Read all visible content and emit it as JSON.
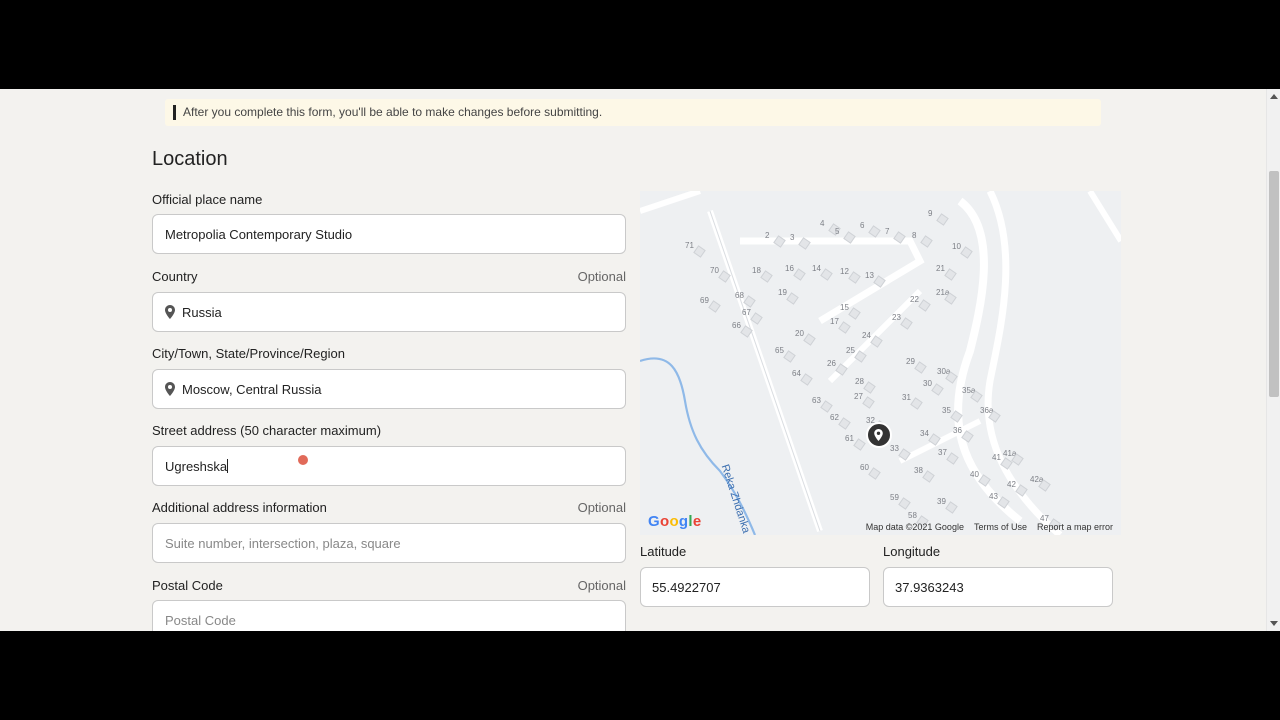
{
  "notice": {
    "text": "After you complete this form, you'll be able to make changes before submitting."
  },
  "section": {
    "title": "Location"
  },
  "form": {
    "place_name": {
      "label": "Official place name",
      "value": "Metropolia Contemporary Studio"
    },
    "country": {
      "label": "Country",
      "optional": "Optional",
      "value": "Russia"
    },
    "city": {
      "label": "City/Town, State/Province/Region",
      "value": "Moscow, Central Russia"
    },
    "street": {
      "label": "Street address (50 character maximum)",
      "value": "Ugreshska"
    },
    "additional": {
      "label": "Additional address information",
      "optional": "Optional",
      "placeholder": "Suite number, intersection, plaza, square"
    },
    "postal": {
      "label": "Postal Code",
      "optional": "Optional",
      "placeholder": "Postal Code"
    }
  },
  "map": {
    "logo": "Google",
    "river_label": "Reka Zhdanka",
    "attribution": "Map data ©2021 Google",
    "terms": "Terms of Use",
    "report": "Report a map error",
    "house_numbers": [
      "71",
      "70",
      "69",
      "68",
      "67",
      "66",
      "65",
      "64",
      "63",
      "62",
      "61",
      "60",
      "59",
      "58",
      "4",
      "2",
      "3",
      "5",
      "6",
      "7",
      "8",
      "9",
      "10",
      "18",
      "16",
      "14",
      "12",
      "13",
      "21",
      "21a",
      "22",
      "19",
      "17",
      "15",
      "23",
      "20",
      "24",
      "25",
      "26",
      "29",
      "30a",
      "27",
      "28",
      "30",
      "31",
      "35a",
      "36a",
      "32",
      "35",
      "34",
      "36",
      "33",
      "37",
      "40",
      "41",
      "41a",
      "38",
      "39",
      "43",
      "42",
      "42a",
      "47"
    ],
    "marker_icon": "location-pin-icon"
  },
  "coordinates": {
    "latitude": {
      "label": "Latitude",
      "value": "55.4922707"
    },
    "longitude": {
      "label": "Longitude",
      "value": "37.9363243"
    }
  },
  "colors": {
    "notice_bg": "#fdf8e7",
    "page_bg": "#f3f2ef",
    "cursor": "#dc503c"
  }
}
